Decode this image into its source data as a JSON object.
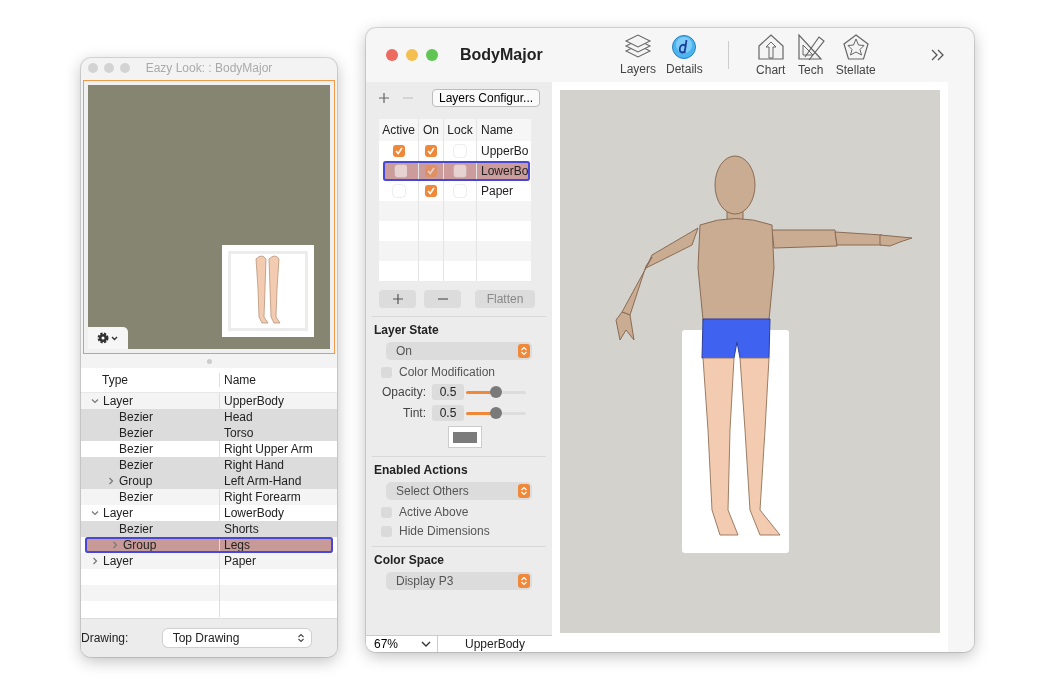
{
  "inspector": {
    "title": "Eazy Look: : BodyMajor",
    "outline": {
      "columns": [
        "Type",
        "Name"
      ],
      "rows": [
        {
          "type": "Layer",
          "name": "UpperBody",
          "expanded": true,
          "selected": false,
          "highlighted": false,
          "children": [
            {
              "type": "Bezier",
              "name": "Head",
              "selected": false,
              "highlighted": true
            },
            {
              "type": "Bezier",
              "name": "Torso",
              "selected": false,
              "highlighted": true
            },
            {
              "type": "Bezier",
              "name": "Right Upper Arm",
              "selected": false,
              "highlighted": false
            },
            {
              "type": "Bezier",
              "name": "Right Hand",
              "selected": false,
              "highlighted": true
            },
            {
              "type": "Group",
              "name": "Left Arm-Hand",
              "expanded": false,
              "selected": false,
              "highlighted": true
            },
            {
              "type": "Bezier",
              "name": "Right Forearm",
              "selected": false,
              "highlighted": false
            }
          ]
        },
        {
          "type": "Layer",
          "name": "LowerBody",
          "expanded": true,
          "selected": false,
          "highlighted": false,
          "children": [
            {
              "type": "Bezier",
              "name": "Shorts",
              "selected": false,
              "highlighted": true
            },
            {
              "type": "Group",
              "name": "Legs",
              "expanded": false,
              "selected": true,
              "highlighted": false
            }
          ]
        },
        {
          "type": "Layer",
          "name": "Paper",
          "expanded": false,
          "selected": false,
          "highlighted": false
        }
      ]
    },
    "drawing_label": "Drawing:",
    "drawing_value": "Top Drawing"
  },
  "main": {
    "title": "BodyMajor",
    "toolbar": [
      {
        "label": "Layers",
        "kind": "layers"
      },
      {
        "label": "Details",
        "kind": "details"
      },
      {
        "label": "Chart",
        "kind": "chart"
      },
      {
        "label": "Tech",
        "kind": "tech"
      },
      {
        "label": "Stellate",
        "kind": "stellate"
      }
    ],
    "configure_button": "Layers Configur...",
    "layers_table": {
      "columns": [
        "Active",
        "On",
        "Lock",
        "Name"
      ],
      "rows": [
        {
          "active": true,
          "on": true,
          "lock": false,
          "name": "UpperBo",
          "selected": false
        },
        {
          "active": false,
          "on": true,
          "lock": false,
          "name": "LowerBo",
          "selected": true
        },
        {
          "active": false,
          "on": true,
          "lock": false,
          "name": "Paper",
          "selected": false
        }
      ]
    },
    "flatten_button": "Flatten",
    "layer_state": {
      "heading": "Layer State",
      "value": "On",
      "color_modification": {
        "label": "Color Modification",
        "checked": false
      },
      "sliders": [
        {
          "label": "Opacity:",
          "value": "0.5",
          "level": 0.5
        },
        {
          "label": "Tint:",
          "value": "0.5",
          "level": 0.5
        }
      ]
    },
    "enabled_actions": {
      "heading": "Enabled Actions",
      "value": "Select Others",
      "options": [
        {
          "label": "Active Above",
          "checked": false
        },
        {
          "label": "Hide Dimensions",
          "checked": false
        }
      ]
    },
    "color_space": {
      "heading": "Color Space",
      "value": "Display P3"
    },
    "zoom": "67%",
    "current_layer": "UpperBody"
  }
}
